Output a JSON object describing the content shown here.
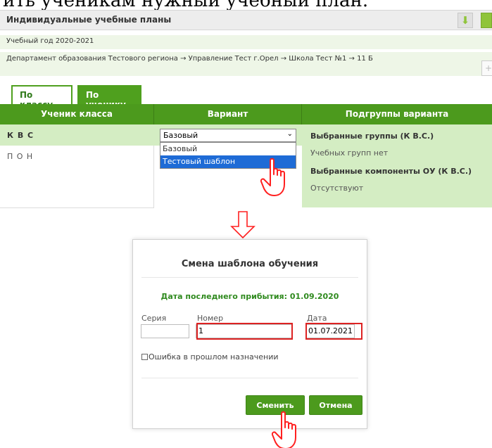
{
  "caption": "ить ученикам нужный учебный план.",
  "panel": {
    "title": "Индивидуальные учебные планы"
  },
  "year": "Учебный год 2020-2021",
  "breadcrumb": "Департамент образования Тестового региона → Управление Тест г.Орел → Школа Тест №1 → 11 Б",
  "tabs": {
    "by_class": "По классу",
    "by_student": "По ученику"
  },
  "grid": {
    "headers": [
      "Ученик класса",
      "Вариант",
      "Подгруппы варианта"
    ],
    "students": [
      "К В С",
      "П О Н"
    ],
    "select_value": "Базовый",
    "options": [
      "Базовый",
      "Тестовый шаблон"
    ],
    "groups_title": "Выбранные группы (К В.С.)",
    "groups_value": "Учебных групп нет",
    "components_title": "Выбранные компоненты ОУ (К В.С.)",
    "components_value": "Отсутствуют"
  },
  "dialog": {
    "title": "Смена шаблона обучения",
    "arrival": "Дата последнего прибытия: 01.09.2020",
    "series_label": "Серия",
    "number_label": "Номер",
    "date_label": "Дата",
    "series_value": "",
    "number_value": "1",
    "date_value": "01.07.2021",
    "checkbox_label": "Ошибка в прошлом назначении",
    "change_label": "Сменить",
    "cancel_label": "Отмена"
  },
  "colors": {
    "green": "#4c9a1d",
    "light_green": "#d4edc3",
    "highlight": "#dd2222",
    "select_blue": "#1e6bd6"
  },
  "icons": [
    "download-arrow-icon",
    "chevron-down-icon",
    "pointer-hand-icon",
    "down-arrow-icon",
    "checkbox-icon"
  ]
}
